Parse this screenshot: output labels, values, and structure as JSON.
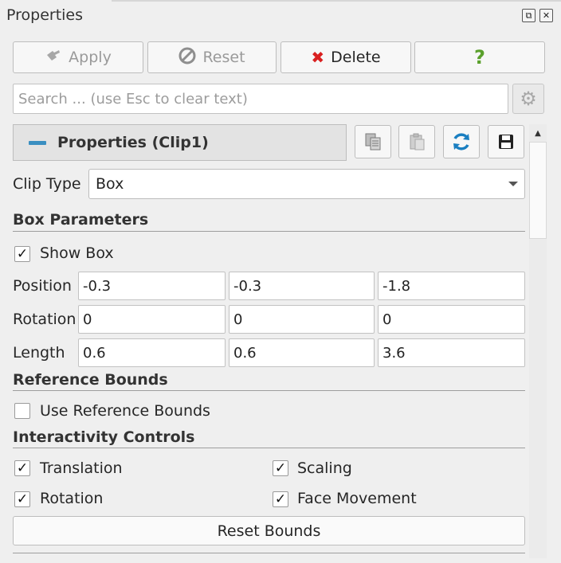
{
  "panel": {
    "title": "Properties"
  },
  "toolbar": {
    "apply_label": "Apply",
    "reset_label": "Reset",
    "delete_label": "Delete",
    "help_label": "?"
  },
  "search": {
    "placeholder": "Search ... (use Esc to clear text)",
    "value": ""
  },
  "section": {
    "title": "Properties (Clip1)"
  },
  "clip_type": {
    "label": "Clip Type",
    "value": "Box"
  },
  "box_params": {
    "heading": "Box Parameters",
    "show_box_label": "Show Box",
    "show_box_checked": true,
    "position_label": "Position",
    "position": [
      "-0.3",
      "-0.3",
      "-1.8"
    ],
    "rotation_label": "Rotation",
    "rotation": [
      "0",
      "0",
      "0"
    ],
    "length_label": "Length",
    "length": [
      "0.6",
      "0.6",
      "3.6"
    ]
  },
  "reference_bounds": {
    "heading": "Reference Bounds",
    "use_label": "Use Reference Bounds",
    "use_checked": false
  },
  "interactivity": {
    "heading": "Interactivity Controls",
    "translation_label": "Translation",
    "scaling_label": "Scaling",
    "rotation_label": "Rotation",
    "face_movement_label": "Face Movement",
    "translation_checked": true,
    "scaling_checked": true,
    "rotation_checked": true,
    "face_movement_checked": true
  },
  "reset_bounds_label": "Reset Bounds",
  "colors": {
    "minus_accent": "#3a8fc1",
    "delete_red": "#d92020",
    "help_green": "#5aa02c",
    "reload_blue": "#1a7fc1"
  }
}
